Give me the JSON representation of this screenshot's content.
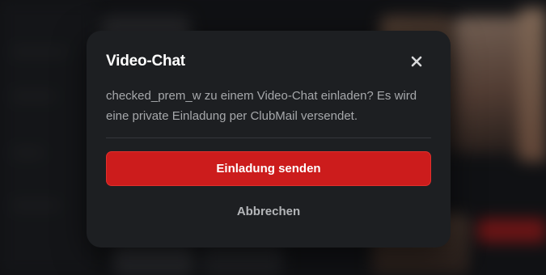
{
  "dialog": {
    "title": "Video-Chat",
    "message": "checked_prem_w zu einem Video-Chat einladen? Es wird eine private Einladung per ClubMail versendet.",
    "primary_button": "Einladung senden",
    "secondary_button": "Abbrechen",
    "close_icon": "close-icon"
  },
  "colors": {
    "dialog_background": "#1d1f22",
    "primary_button": "#cc1c1c",
    "title_text": "#ffffff",
    "body_text": "#a6a8ab"
  }
}
